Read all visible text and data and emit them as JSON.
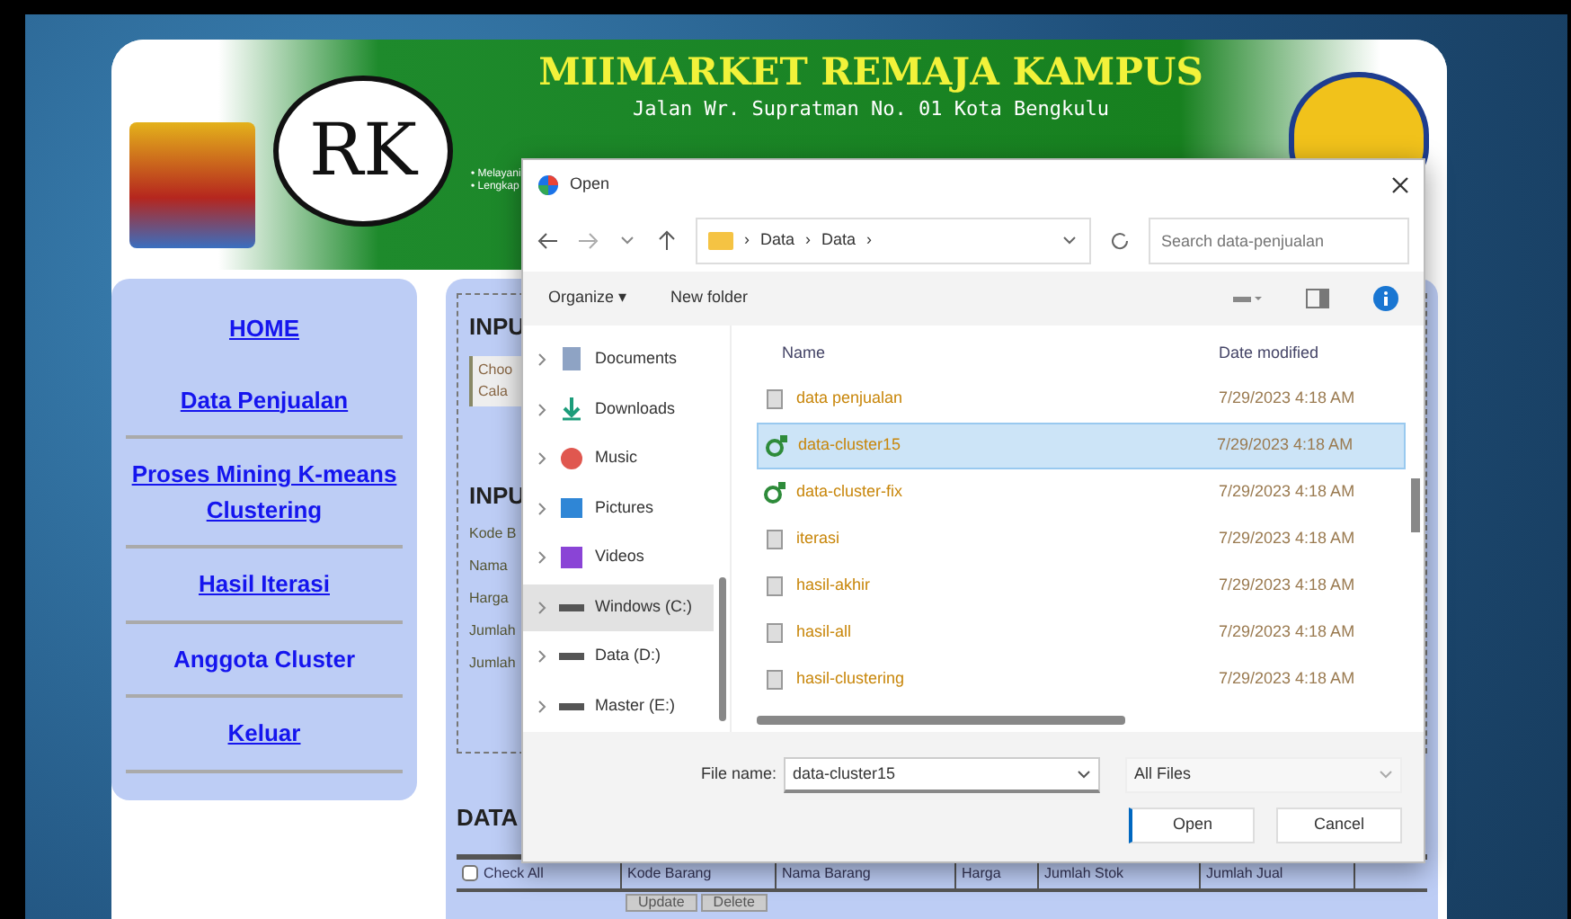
{
  "header": {
    "title": "MIIMARKET REMAJA KAMPUS",
    "address": "Jalan Wr. Supratman No. 01  Kota Bengkulu",
    "logo_text": "RK",
    "tagline": [
      "• Melayani",
      "• Lengkap"
    ]
  },
  "sidebar": {
    "items": [
      {
        "label": "HOME",
        "underlined": true
      },
      {
        "label": "Data Penjualan",
        "underlined": true
      },
      {
        "label": "Proses Mining K-means Clustering",
        "underlined": true
      },
      {
        "label": "Hasil Iterasi",
        "underlined": true
      },
      {
        "label": "Anggota Cluster",
        "underlined": false
      },
      {
        "label": "Keluar",
        "underlined": true
      }
    ]
  },
  "main": {
    "input_title_1": "INPU",
    "choose_lines": [
      "Choo",
      "Cala"
    ],
    "input_title_2": "INPU",
    "form_labels": [
      "Kode B",
      "Nama",
      "Harga",
      "Jumlah",
      "Jumlah"
    ],
    "data_title": "DATA",
    "table": {
      "columns": [
        {
          "label": "Check All",
          "kind": "checkbox",
          "checked": false
        },
        {
          "label": "Kode Barang",
          "kind": "text"
        },
        {
          "label": "Nama Barang",
          "kind": "text"
        },
        {
          "label": "Harga",
          "kind": "text"
        },
        {
          "label": "Jumlah Stok",
          "kind": "text"
        },
        {
          "label": "Jumlah Jual",
          "kind": "text"
        }
      ],
      "row_buttons": [
        "Update",
        "Delete"
      ]
    }
  },
  "dialog": {
    "title": "Open",
    "path": [
      "Data",
      "Data"
    ],
    "path_separator": "›",
    "search_placeholder": "Search data-penjualan",
    "toolbar": [
      "Organize ▾",
      "New folder"
    ],
    "nav": [
      {
        "label": "Documents",
        "kind": "documents",
        "selected": false
      },
      {
        "label": "Downloads",
        "kind": "downloads",
        "selected": false
      },
      {
        "label": "Music",
        "kind": "music",
        "selected": false
      },
      {
        "label": "Pictures",
        "kind": "pictures",
        "selected": false
      },
      {
        "label": "Videos",
        "kind": "videos",
        "selected": false
      },
      {
        "label": "Windows (C:)",
        "kind": "drive",
        "selected": true
      },
      {
        "label": "Data (D:)",
        "kind": "drive",
        "selected": false
      },
      {
        "label": "Master (E:)",
        "kind": "drive",
        "selected": false
      }
    ],
    "columns": [
      "Name",
      "Date modified"
    ],
    "files": [
      {
        "name": "data penjualan",
        "kind": "doc",
        "selected": false,
        "modified": "7/29/2023 4:18 AM"
      },
      {
        "name": "data-cluster15",
        "kind": "sheet",
        "selected": true,
        "modified": "7/29/2023 4:18 AM"
      },
      {
        "name": "data-cluster-fix",
        "kind": "sheet",
        "selected": false,
        "modified": "7/29/2023 4:18 AM"
      },
      {
        "name": "iterasi",
        "kind": "doc",
        "selected": false,
        "modified": "7/29/2023 4:18 AM"
      },
      {
        "name": "hasil-akhir",
        "kind": "doc",
        "selected": false,
        "modified": "7/29/2023 4:18 AM"
      },
      {
        "name": "hasil-all",
        "kind": "doc",
        "selected": false,
        "modified": "7/29/2023 4:18 AM"
      },
      {
        "name": "hasil-clustering",
        "kind": "doc",
        "selected": false,
        "modified": "7/29/2023 4:18 AM"
      }
    ],
    "file_name_label": "File name:",
    "file_name": "data-cluster15",
    "file_type": "All Files",
    "buttons": [
      "Open",
      "Cancel"
    ]
  }
}
